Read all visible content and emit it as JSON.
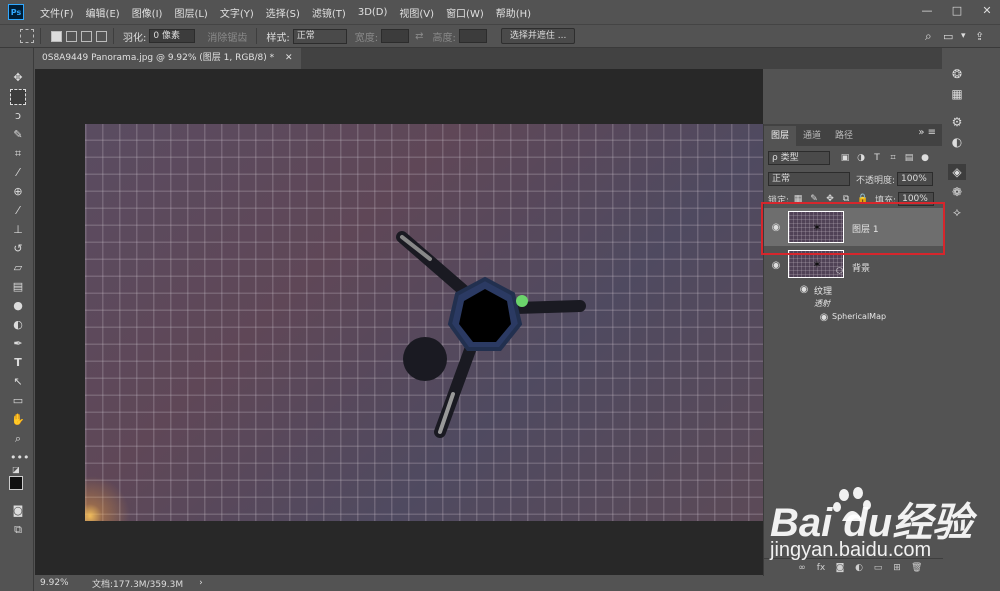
{
  "app": {
    "logo": "Ps",
    "menu": [
      "文件(F)",
      "编辑(E)",
      "图像(I)",
      "图层(L)",
      "文字(Y)",
      "选择(S)",
      "滤镜(T)",
      "3D(D)",
      "视图(V)",
      "窗口(W)",
      "帮助(H)"
    ],
    "window_controls": [
      "—",
      "□",
      "✕"
    ]
  },
  "options": {
    "feather_label": "羽化:",
    "feather_value": "0 像素",
    "antialias_label": "消除锯齿",
    "style_label": "样式:",
    "style_value": "正常",
    "width_label": "宽度:",
    "height_label": "高度:",
    "select_mask_button": "选择并遮住 ..."
  },
  "document": {
    "tab_title": "0S8A9449 Panorama.jpg @ 9.92% (图层 1, RGB/8) *",
    "tab_close": "✕"
  },
  "status": {
    "zoom": "9.92%",
    "doc_info": "文档:177.3M/359.3M",
    "arrow": "›"
  },
  "layers_panel": {
    "tabs": [
      "图层",
      "通道",
      "路径"
    ],
    "kind_filter": "ρ 类型",
    "blend_mode": "正常",
    "opacity_label": "不透明度:",
    "opacity_value": "100%",
    "lock_label": "锁定:",
    "fill_label": "填充:",
    "fill_value": "100%",
    "layers": [
      {
        "name": "图层 1",
        "visible": true,
        "selected": true
      },
      {
        "name": "背景",
        "visible": true,
        "selected": false
      }
    ],
    "effects": {
      "group": "纹理",
      "sub": "透射",
      "item": "SphericalMap"
    }
  },
  "watermark": {
    "logo": "Bai  du经验",
    "url": "jingyan.baidu.com"
  },
  "colors": {
    "ui_bg": "#535353",
    "canvas_bg": "#282828",
    "highlight": "#d6262c",
    "ps_blue": "#31a8ff"
  }
}
